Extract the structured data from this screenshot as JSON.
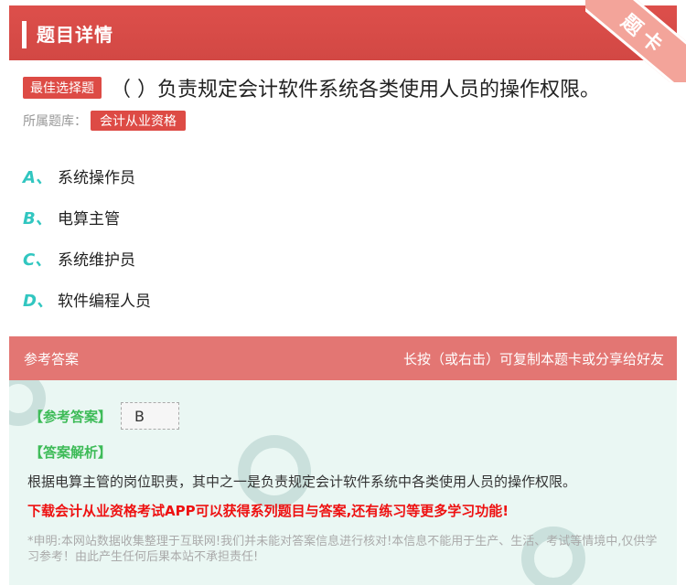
{
  "header": {
    "title": "题目详情",
    "ribbon": "题卡"
  },
  "question": {
    "type_tag": "最佳选择题",
    "text": "（   ）负责规定会计软件系统各类使用人员的操作权限。",
    "library_label": "所属题库：",
    "library_tag": "会计从业资格"
  },
  "options": [
    {
      "letter": "A、",
      "text": "系统操作员"
    },
    {
      "letter": "B、",
      "text": "电算主管"
    },
    {
      "letter": "C、",
      "text": "系统维护员"
    },
    {
      "letter": "D、",
      "text": "软件编程人员"
    }
  ],
  "answer": {
    "head_left": "参考答案",
    "head_right": "长按（或右击）可复制本题卡或分享给好友",
    "answer_tag": "【参考答案】",
    "answer_value": "B",
    "analysis_tag": "【答案解析】",
    "analysis_text": "根据电算主管的岗位职责，其中之一是负责规定会计软件系统中各类使用人员的操作权限。",
    "promo": "下载会计从业资格考试APP可以获得系列题目与答案,还有练习等更多学习功能!",
    "disclaimer": "*申明:本网站数据收集整理于互联网!我们并未能对答案信息进行核对!本信息不能用于生产、生活、考试等情境中,仅供学习参考！由此产生任何后果本站不承担责任!"
  },
  "colors": {
    "brand_red": "#d9534f",
    "option_letter": "#31c6c0",
    "answer_green": "#3dbb57",
    "promo_red": "#ee1111"
  }
}
